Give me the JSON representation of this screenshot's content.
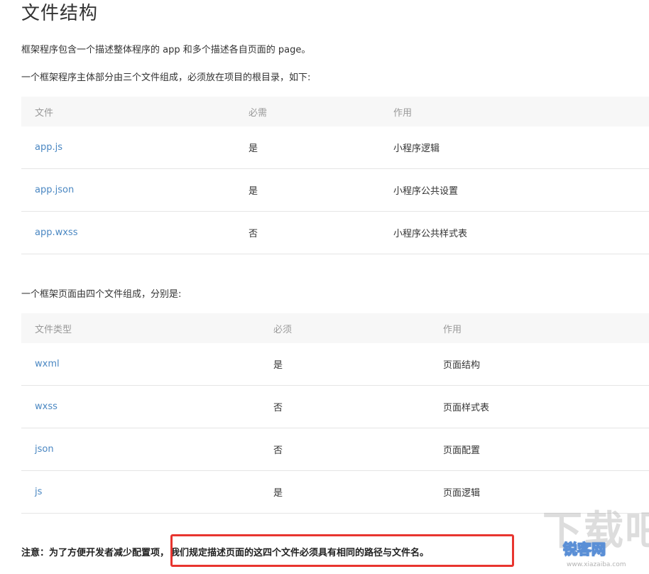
{
  "doc": {
    "title": "文件结构",
    "intro": "框架程序包含一个描述整体程序的 app 和多个描述各自页面的 page。",
    "app_para": "一个框架程序主体部分由三个文件组成，必须放在项目的根目录，如下:",
    "app_table": {
      "headers": [
        "文件",
        "必需",
        "作用"
      ],
      "rows": [
        [
          "app.js",
          "是",
          "小程序逻辑"
        ],
        [
          "app.json",
          "是",
          "小程序公共设置"
        ],
        [
          "app.wxss",
          "否",
          "小程序公共样式表"
        ]
      ]
    },
    "page_para": "一个框架页面由四个文件组成，分别是:",
    "page_table": {
      "headers": [
        "文件类型",
        "必须",
        "作用"
      ],
      "rows": [
        [
          "wxml",
          "是",
          "页面结构"
        ],
        [
          "wxss",
          "否",
          "页面样式表"
        ],
        [
          "json",
          "否",
          "页面配置"
        ],
        [
          "js",
          "是",
          "页面逻辑"
        ]
      ]
    },
    "note_prefix": "注意：为了方便开发者减少配置项，",
    "note_emph": "我们规定描述页面的这四个文件必须具有相同的路径与文件名。"
  },
  "watermark": {
    "large": "下载吧",
    "logo": "锐客网",
    "url": "www.xiazaiba.com"
  },
  "colors": {
    "link": "#4a87c2",
    "header_bg": "#f7f7f7",
    "highlight": "#e8352f"
  }
}
